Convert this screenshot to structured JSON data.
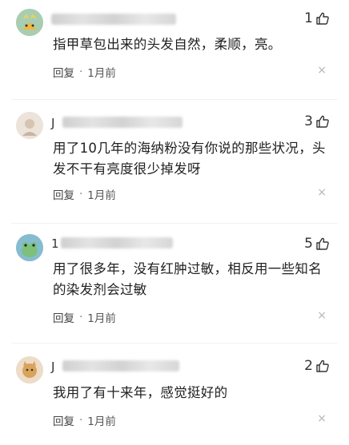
{
  "comments": [
    {
      "name_prefix": "",
      "likes": "1",
      "text": "指甲草包出来的头发自然，柔顺，亮。",
      "reply_label": "回复",
      "separator": "·",
      "time": "1月前",
      "close_glyph": "×"
    },
    {
      "name_prefix": "J",
      "likes": "3",
      "text": "用了10几年的海纳粉没有你说的那些状况，头发不干有亮度很少掉发呀",
      "reply_label": "回复",
      "separator": "·",
      "time": "1月前",
      "close_glyph": "×"
    },
    {
      "name_prefix": "1",
      "likes": "5",
      "text": "用了很多年，没有红肿过敏，相反用一些知名的染发剂会过敏",
      "reply_label": "回复",
      "separator": "·",
      "time": "1月前",
      "close_glyph": "×"
    },
    {
      "name_prefix": "J",
      "likes": "2",
      "text": "我用了有十来年，感觉挺好的",
      "reply_label": "回复",
      "separator": "·",
      "time": "1月前",
      "close_glyph": "×"
    }
  ],
  "icons": {
    "like": "thumbs-up-icon",
    "close": "close-icon"
  },
  "colors": {
    "text": "#1f1f1f",
    "meta": "#444444",
    "close": "#b5b5b5"
  }
}
